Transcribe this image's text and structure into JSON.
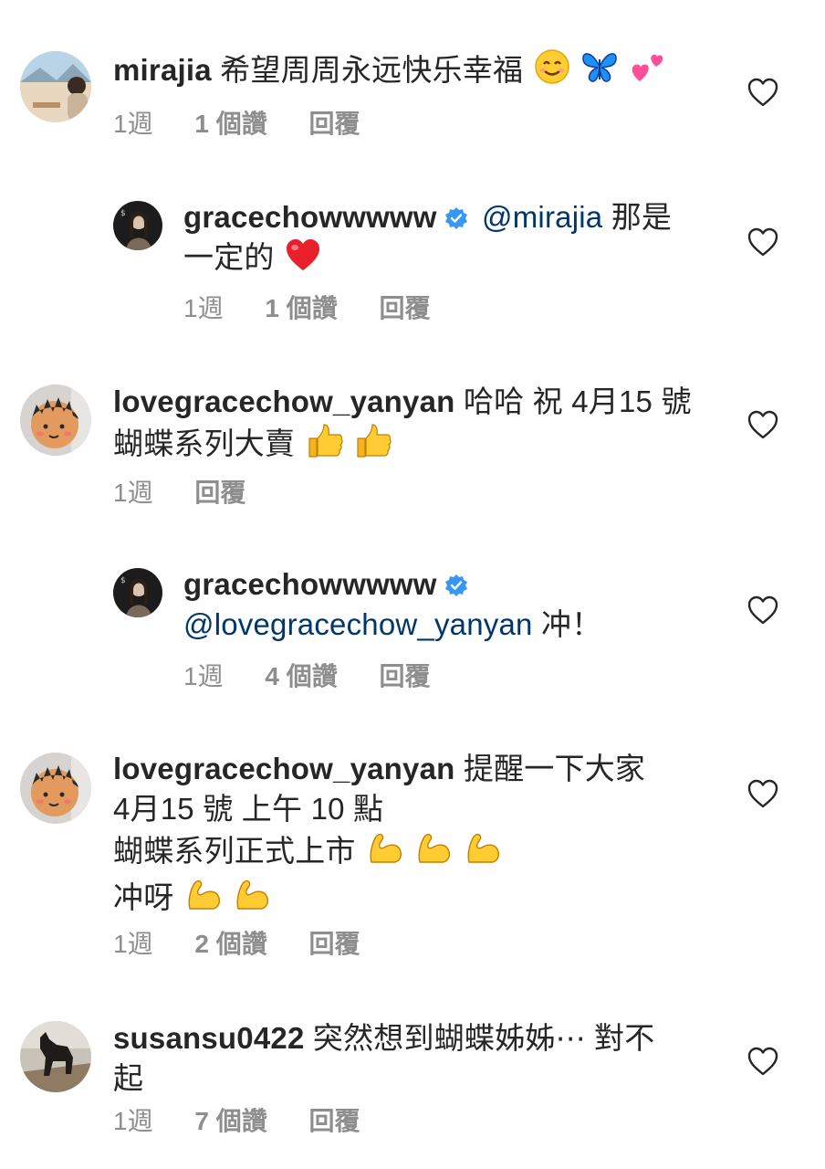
{
  "comments": [
    {
      "type": "main",
      "username": "mirajia",
      "lines": [
        "希望周周永远快乐幸福"
      ],
      "emojis": [
        "smiling-face-emoji",
        "butterfly-emoji",
        "two-hearts-emoji"
      ],
      "time": "1週",
      "likes": "1 個讚",
      "reply": "回覆"
    },
    {
      "type": "reply",
      "username": "gracechowwwww",
      "verified": true,
      "mention": "@mirajia",
      "lines": [
        "那是",
        "一定的"
      ],
      "emojis": [
        "red-heart-emoji"
      ],
      "time": "1週",
      "likes": "1 個讚",
      "reply": "回覆"
    },
    {
      "type": "main",
      "username": "lovegracechow_yanyan",
      "lines": [
        "哈哈 祝 4月15 號",
        "蝴蝶系列大賣"
      ],
      "emojis": [
        "thumbs-up-emoji",
        "thumbs-up-emoji"
      ],
      "time": "1週",
      "likes": "",
      "reply": "回覆"
    },
    {
      "type": "reply",
      "username": "gracechowwwww",
      "verified": true,
      "mention": "@lovegracechow_yanyan",
      "lines": [
        "冲！"
      ],
      "emojis": [],
      "time": "1週",
      "likes": "4 個讚",
      "reply": "回覆"
    },
    {
      "type": "main",
      "username": "lovegracechow_yanyan",
      "lines": [
        "提醒一下大家",
        "4月15 號 上午 10 點",
        "蝴蝶系列正式上市",
        "冲呀"
      ],
      "emojis": [
        "flexed-biceps-emoji"
      ],
      "time": "1週",
      "likes": "2 個讚",
      "reply": "回覆"
    },
    {
      "type": "main",
      "username": "susansu0422",
      "lines": [
        "突然想到蝴蝶姊姊⋯ 對不",
        "起"
      ],
      "emojis": [],
      "time": "1週",
      "likes": "7 個讚",
      "reply": "回覆"
    }
  ],
  "colors": {
    "text": "#262626",
    "meta": "#8e8e8e",
    "mention": "#00376b",
    "verified": "#3897f0"
  }
}
